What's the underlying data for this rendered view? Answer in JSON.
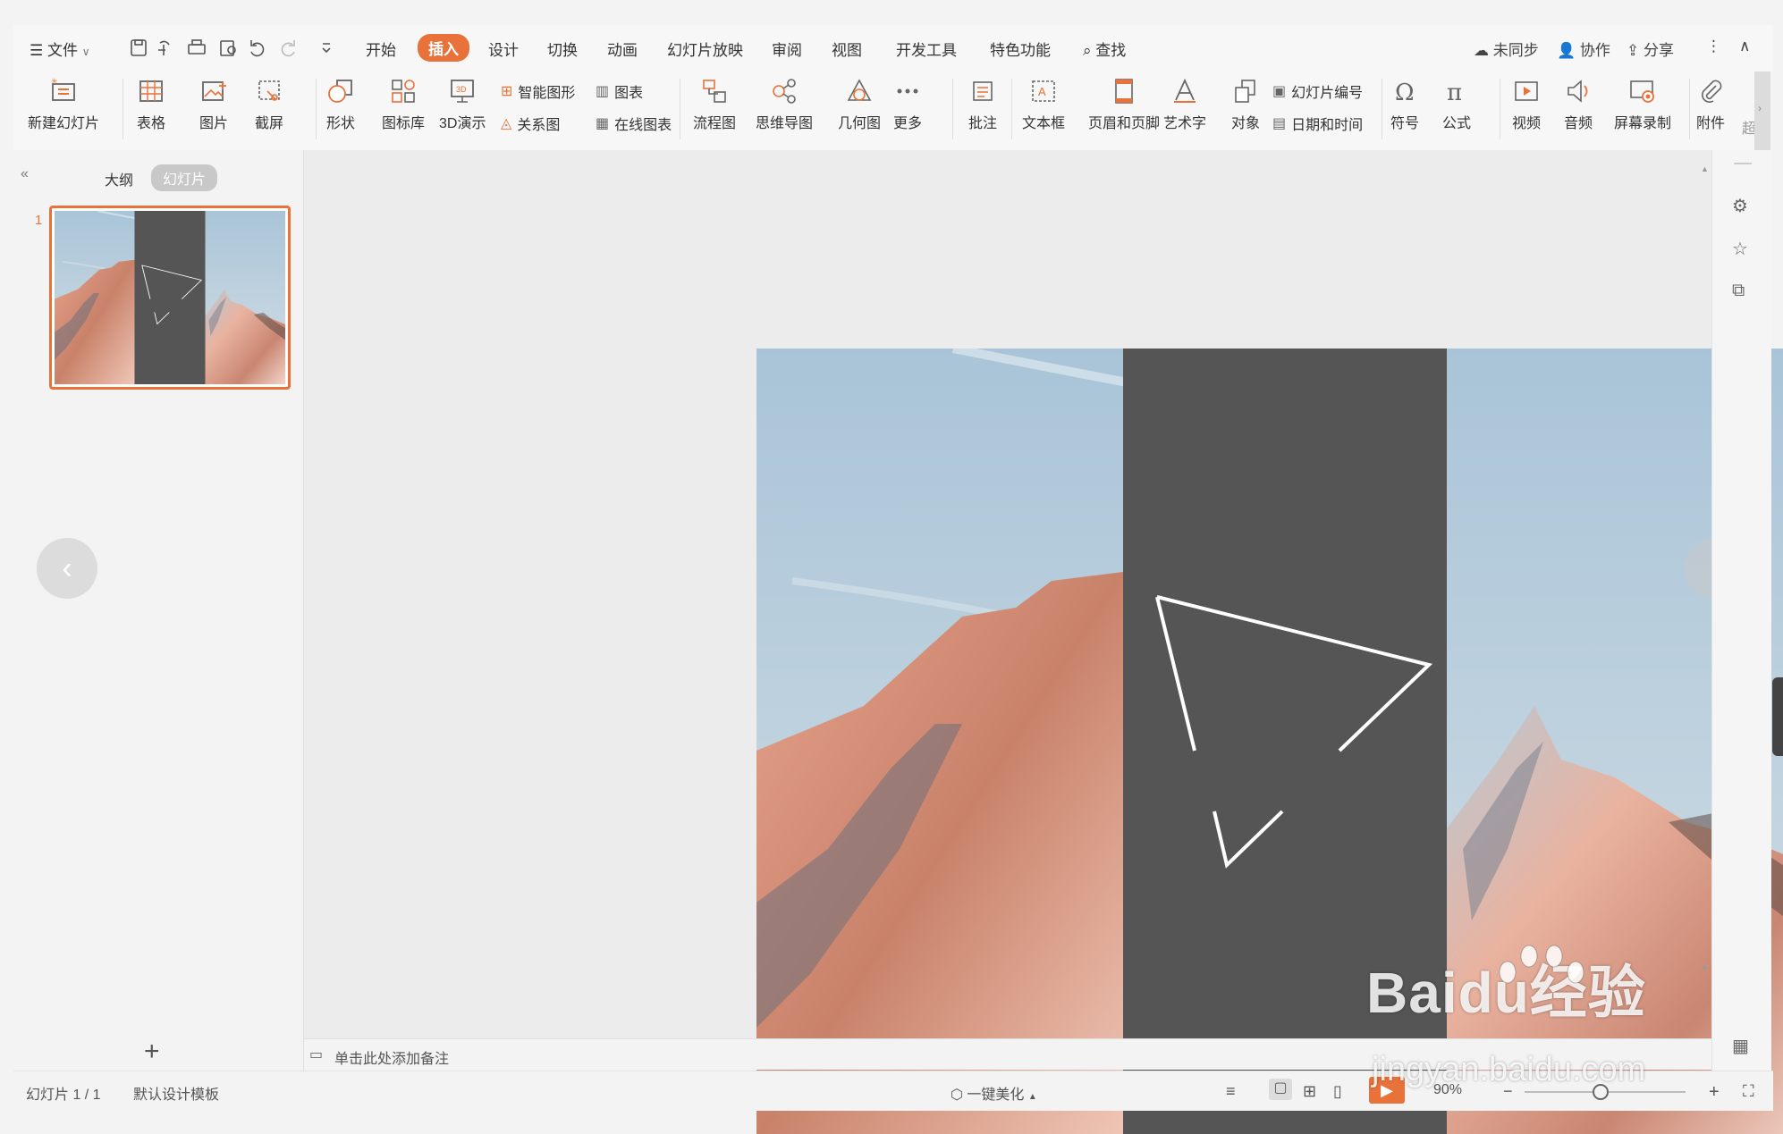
{
  "menu": {
    "file": "文件",
    "tabs": [
      "开始",
      "插入",
      "设计",
      "切换",
      "动画",
      "幻灯片放映",
      "审阅",
      "视图",
      "开发工具",
      "特色功能"
    ],
    "active_tab": "插入",
    "search": "查找",
    "sync": "未同步",
    "collab": "协作",
    "share": "分享"
  },
  "ribbon": {
    "new_slide": "新建幻灯片",
    "table": "表格",
    "picture": "图片",
    "screenshot": "截屏",
    "shape": "形状",
    "icon_lib": "图标库",
    "demo3d": "3D演示",
    "smart_art": "智能图形",
    "chart": "图表",
    "relation": "关系图",
    "online_chart": "在线图表",
    "flowchart": "流程图",
    "mindmap": "思维导图",
    "geometry": "几何图",
    "more": "更多",
    "comment": "批注",
    "textbox": "文本框",
    "header_footer": "页眉和页脚",
    "wordart": "艺术字",
    "object": "对象",
    "slide_number": "幻灯片编号",
    "datetime": "日期和时间",
    "symbol": "符号",
    "formula": "公式",
    "video": "视频",
    "audio": "音频",
    "screen_record": "屏幕录制",
    "attachment": "附件",
    "hyper": "超"
  },
  "left_panel": {
    "tab_outline": "大纲",
    "tab_slides": "幻灯片",
    "slide_number": "1",
    "add": "+"
  },
  "notes_placeholder": "单击此处添加备注",
  "status": {
    "slide_info": "幻灯片 1 / 1",
    "template": "默认设计模板",
    "beautify": "一键美化",
    "zoom": "90%"
  },
  "watermark": {
    "brand": "Baidu经验",
    "url": "jingyan.baidu.com"
  },
  "colors": {
    "accent": "#e9723a",
    "slide_band": "#555555",
    "sky": "#b7cfe0"
  }
}
